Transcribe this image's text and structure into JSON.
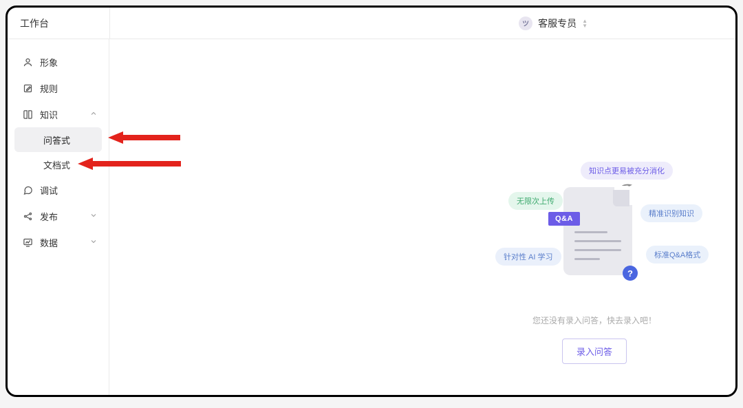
{
  "header": {
    "title": "工作台",
    "role": {
      "avatar_initial": "ツ",
      "label": "客服专员"
    }
  },
  "sidebar": {
    "items": [
      {
        "icon": "person",
        "label": "形象",
        "expandable": false
      },
      {
        "icon": "edit",
        "label": "规则",
        "expandable": false
      },
      {
        "icon": "book",
        "label": "知识",
        "expandable": true,
        "expanded": true,
        "children": [
          {
            "label": "问答式",
            "active": true
          },
          {
            "label": "文档式",
            "active": false
          }
        ]
      },
      {
        "icon": "chat",
        "label": "调试",
        "expandable": false
      },
      {
        "icon": "share",
        "label": "发布",
        "expandable": true,
        "expanded": false
      },
      {
        "icon": "chart",
        "label": "数据",
        "expandable": true,
        "expanded": false
      }
    ]
  },
  "empty": {
    "pills": {
      "green": "无限次上传",
      "purple": "知识点更易被充分消化",
      "blue1": "精准识别知识",
      "indigo": "针对性 AI 学习",
      "blue2": "标准Q&A格式"
    },
    "qa_tag": "Q&A",
    "q_mark": "?",
    "hint": "您还没有录入问答，快去录入吧！",
    "button": "录入问答"
  }
}
